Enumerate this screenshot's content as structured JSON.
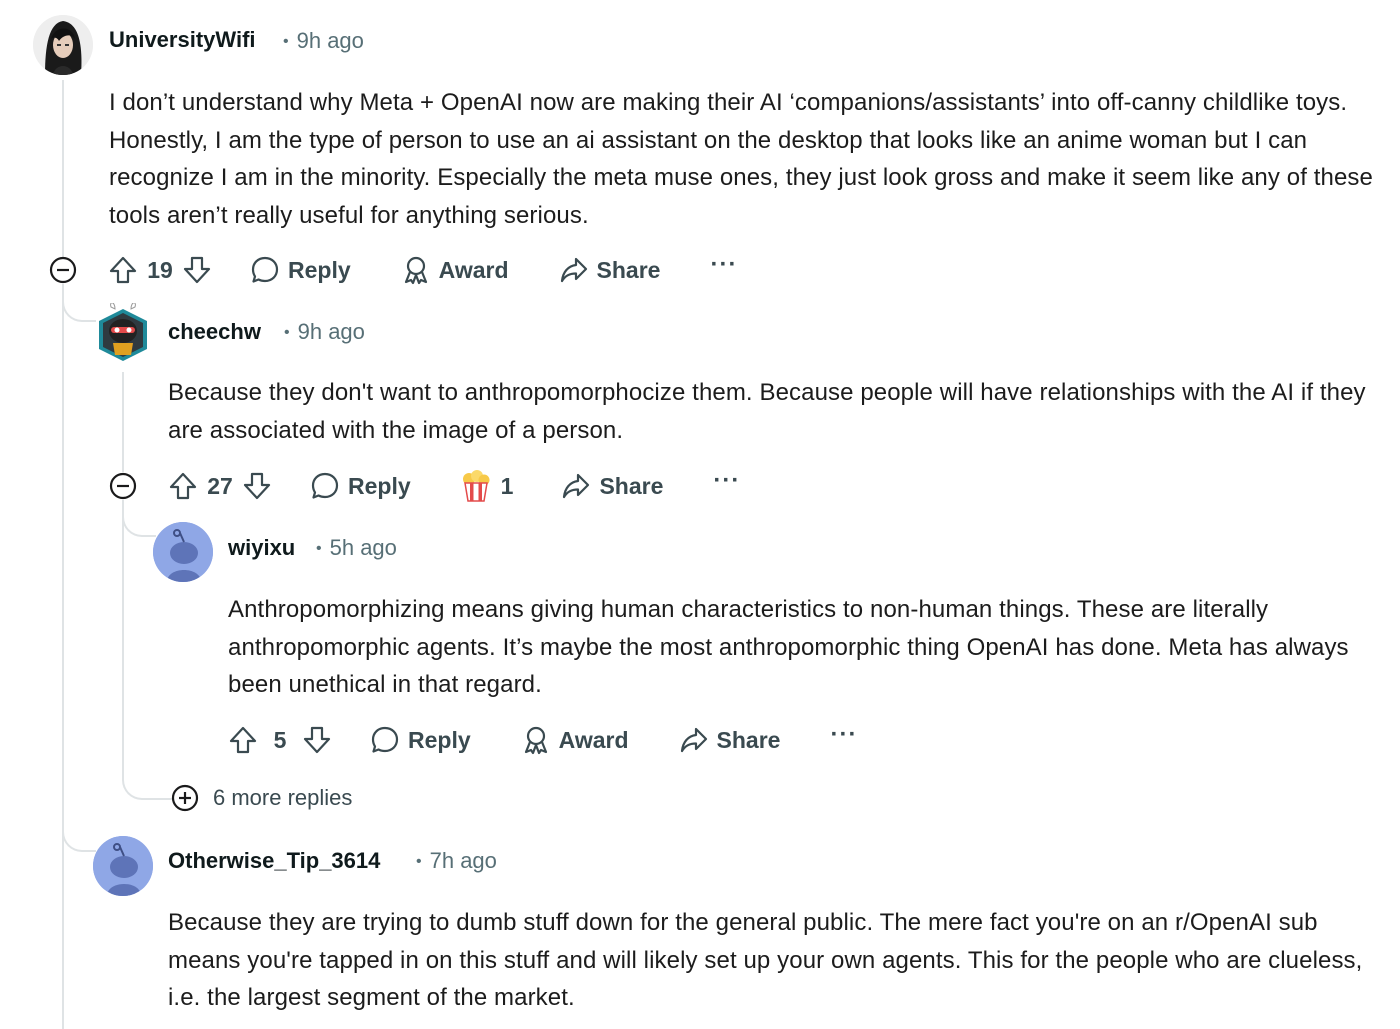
{
  "comments": [
    {
      "username": "UniversityWifi",
      "time": "9h ago",
      "avatar": "anime-portrait-avatar",
      "text": "I don’t understand why Meta + OpenAI now are making their AI ‘companions/assistants’ into off-canny childlike toys. Honestly, I am the type of person to use an ai assistant on the desktop that looks like an anime woman but I can recognize I am in the minority. Especially the meta muse ones, they just look gross and make it seem like any of these tools aren’t really useful for anything serious.",
      "votes": "19",
      "reply_label": "Reply",
      "award_label": "Award",
      "share_label": "Share"
    },
    {
      "username": "cheechw",
      "time": "9h ago",
      "avatar": "ninja-bunny-avatar",
      "text": "Because they don't want to anthropomorphocize them. Because people will have relationships with the AI if they are associated with the image of a person.",
      "votes": "27",
      "reply_label": "Reply",
      "award_count": "1",
      "award_icon": "popcorn-award-icon",
      "share_label": "Share"
    },
    {
      "username": "wiyixu",
      "time": "5h ago",
      "avatar": "default-snoo-avatar",
      "text": "Anthropomorphizing means giving human characteristics to non-human things. These are literally anthropomorphic agents. It’s maybe the most anthropomorphic thing OpenAI has done. Meta has always been unethical in that regard.",
      "votes": "5",
      "reply_label": "Reply",
      "award_label": "Award",
      "share_label": "Share"
    },
    {
      "username": "Otherwise_Tip_3614",
      "time": "7h ago",
      "avatar": "default-snoo-avatar",
      "text": "Because they are trying to dumb stuff down for the general public. The mere fact you're on an r/OpenAI sub means you're tapped in on this stuff and will likely set up your own agents. This for the people who are clueless, i.e. the largest segment of the market."
    }
  ],
  "more_replies": "6 more replies",
  "separator": "•",
  "overflow_label": "···",
  "colors": {
    "text": "#1c1c1c",
    "meta": "#576f76",
    "thread_line": "#dfe3e5",
    "snoo_bg": "#8fa7e6"
  }
}
